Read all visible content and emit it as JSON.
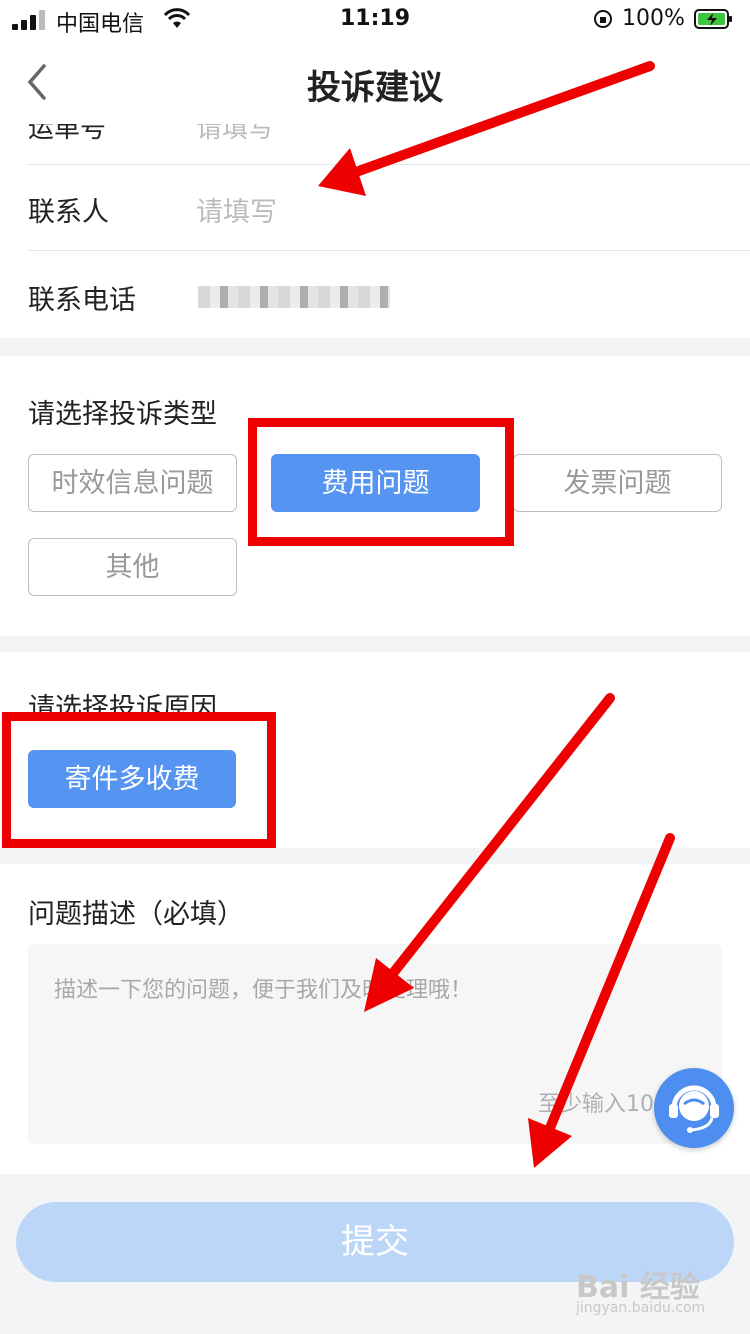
{
  "status_bar": {
    "carrier": "中国电信",
    "time": "11:19",
    "battery": "100%"
  },
  "nav": {
    "title": "投诉建议"
  },
  "contact": {
    "partial_label": "运单号",
    "partial_value": "请填写",
    "contact_person_label": "联系人",
    "contact_person_placeholder": "请填写",
    "phone_label": "联系电话"
  },
  "complaint_type": {
    "title": "请选择投诉类型",
    "options": [
      "时效信息问题",
      "费用问题",
      "发票问题",
      "其他"
    ],
    "selected": "费用问题"
  },
  "complaint_reason": {
    "title": "请选择投诉原因",
    "options": [
      "寄件多收费"
    ],
    "selected": "寄件多收费"
  },
  "description": {
    "title": "问题描述（必填）",
    "placeholder": "描述一下您的问题，便于我们及时处理哦！",
    "counter": "至少输入10"
  },
  "submit": {
    "label": "提交"
  },
  "watermark": {
    "line1": "Bai 经验",
    "line2": "jingyan.baidu.com"
  },
  "colors": {
    "accent": "#5594f0",
    "submit_disabled": "#bcd6f7",
    "annotation_red": "#ee0000"
  }
}
